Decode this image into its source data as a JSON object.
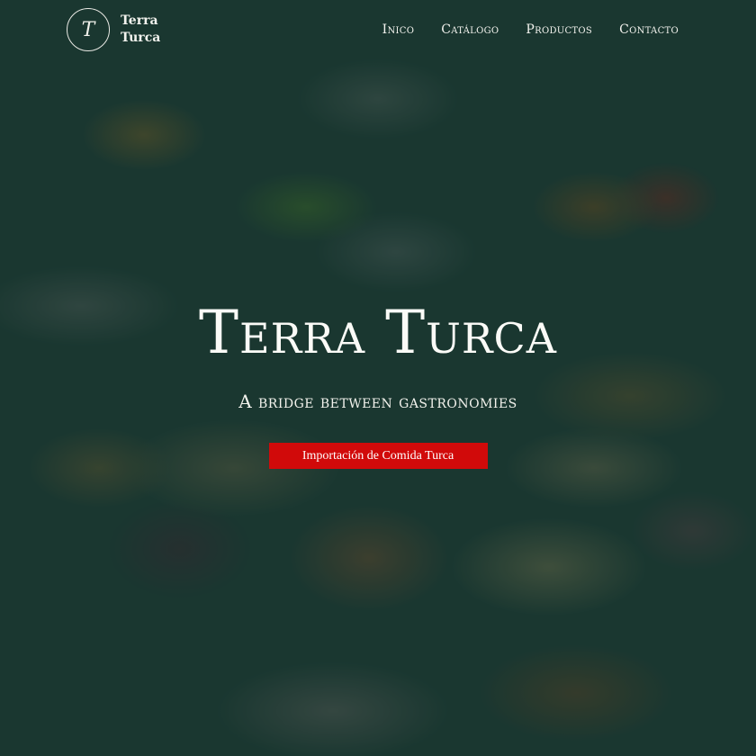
{
  "brand": {
    "logo_letter": "T",
    "name_line1": "Terra",
    "name_line2": "Turca"
  },
  "nav": {
    "items": [
      {
        "label": "Inico"
      },
      {
        "label": "Catálogo"
      },
      {
        "label": "Productos"
      },
      {
        "label": "Contacto"
      }
    ]
  },
  "hero": {
    "title": "Terra Turca",
    "subtitle": "A bridge between gastronomies",
    "cta_label": "Importación de Comida Turca",
    "cta_color": "#d10a0a",
    "overlay_color": "#16342e"
  }
}
